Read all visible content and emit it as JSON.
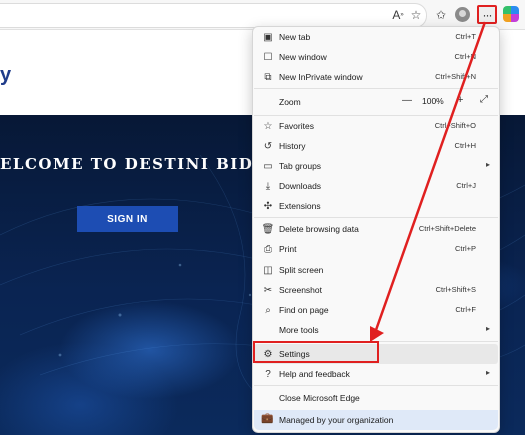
{
  "toolbar": {
    "icons": [
      "read-aloud-icon",
      "favorite-star-icon",
      "favorites-collection-icon",
      "profile-avatar",
      "more-options-icon",
      "copilot-icon"
    ],
    "more_label": "···"
  },
  "page": {
    "header_fragment": "y",
    "hero_title": "ELCOME TO DESTINI BID DAY",
    "signin_label": "SIGN IN"
  },
  "menu": {
    "new_tab": {
      "label": "New tab",
      "shortcut": "Ctrl+T"
    },
    "new_window": {
      "label": "New window",
      "shortcut": "Ctrl+N"
    },
    "new_inprivate": {
      "label": "New InPrivate window",
      "shortcut": "Ctrl+Shift+N"
    },
    "zoom": {
      "label": "Zoom",
      "value": "100%",
      "minus": "—",
      "plus": "+"
    },
    "favorites": {
      "label": "Favorites",
      "shortcut": "Ctrl+Shift+O"
    },
    "history": {
      "label": "History",
      "shortcut": "Ctrl+H"
    },
    "tab_groups": {
      "label": "Tab groups"
    },
    "downloads": {
      "label": "Downloads",
      "shortcut": "Ctrl+J"
    },
    "extensions": {
      "label": "Extensions"
    },
    "delete_browsing": {
      "label": "Delete browsing data",
      "shortcut": "Ctrl+Shift+Delete"
    },
    "print": {
      "label": "Print",
      "shortcut": "Ctrl+P"
    },
    "split_screen": {
      "label": "Split screen"
    },
    "screenshot": {
      "label": "Screenshot",
      "shortcut": "Ctrl+Shift+S"
    },
    "find_on_page": {
      "label": "Find on page",
      "shortcut": "Ctrl+F"
    },
    "more_tools": {
      "label": "More tools"
    },
    "settings": {
      "label": "Settings"
    },
    "help": {
      "label": "Help and feedback"
    },
    "close_edge": {
      "label": "Close Microsoft Edge"
    },
    "managed": {
      "label": "Managed by your organization"
    }
  },
  "annotation": {
    "color": "#e02020"
  }
}
